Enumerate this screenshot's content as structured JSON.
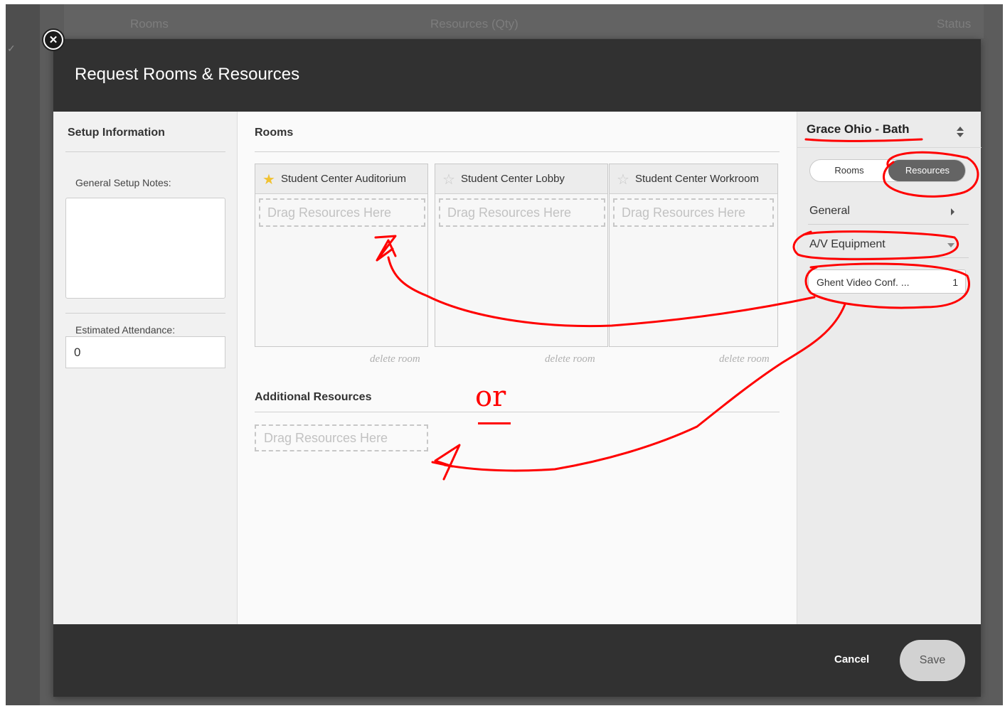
{
  "background": {
    "columns": [
      "Rooms",
      "Resources (Qty)",
      "Status"
    ]
  },
  "modal": {
    "title": "Request Rooms & Resources",
    "close_icon": "close-circle-icon"
  },
  "setup": {
    "title": "Setup Information",
    "notes_label": "General Setup Notes:",
    "notes_value": "",
    "attendance_label": "Estimated Attendance:",
    "attendance_value": "0"
  },
  "rooms": {
    "title": "Rooms",
    "cards": [
      {
        "name": "Student Center Auditorium",
        "starred": true,
        "drop_text": "Drag Resources Here",
        "delete": "delete room"
      },
      {
        "name": "Student Center Lobby",
        "starred": false,
        "drop_text": "Drag Resources Here",
        "delete": "delete room"
      },
      {
        "name": "Student Center Workroom",
        "starred": false,
        "drop_text": "Drag Resources Here",
        "delete": "delete room"
      }
    ]
  },
  "additional": {
    "title": "Additional Resources",
    "drop_text": "Drag Resources Here"
  },
  "sidebar": {
    "venue": "Grace Ohio - Bath",
    "toggle": {
      "rooms": "Rooms",
      "resources": "Resources",
      "active": "resources"
    },
    "categories": [
      {
        "label": "General",
        "state": "collapsed"
      },
      {
        "label": "A/V Equipment",
        "state": "expanded"
      }
    ],
    "resources": [
      {
        "name": "Ghent Video Conf. ...",
        "qty": "1"
      }
    ]
  },
  "footer": {
    "cancel": "Cancel",
    "save": "Save"
  },
  "annotation": {
    "note": "or",
    "color": "#ff0000"
  }
}
